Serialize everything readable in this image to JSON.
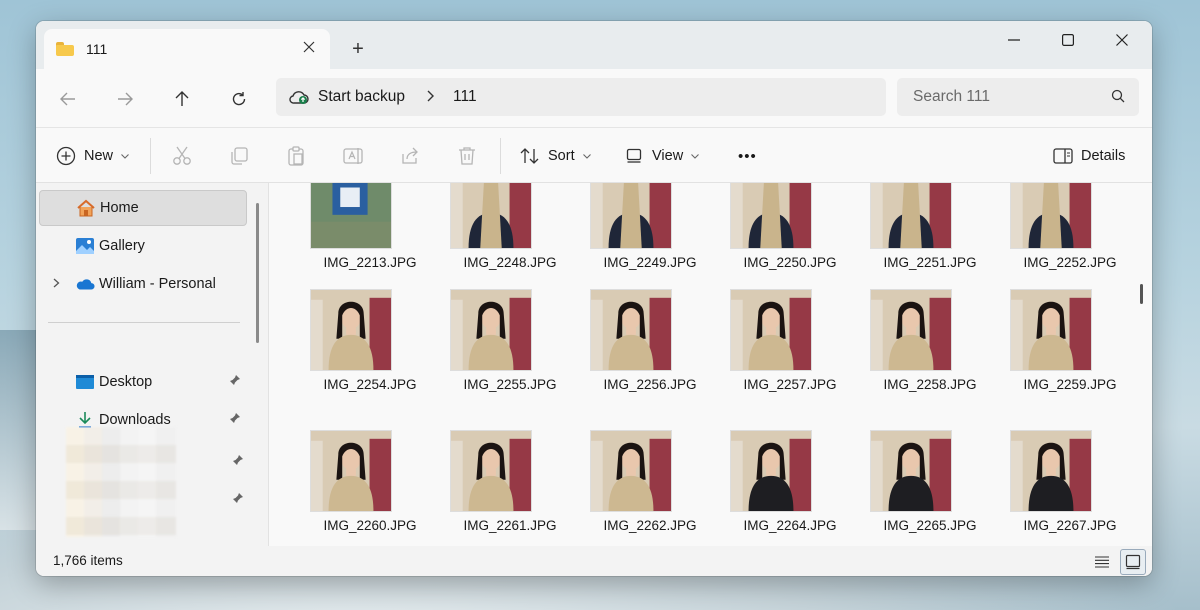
{
  "window": {
    "tab_title": "111",
    "new_tab_symbol": "+"
  },
  "address": {
    "crumbs": [
      "Start backup",
      "111"
    ],
    "search_placeholder": "Search 111"
  },
  "commands": {
    "new_label": "New",
    "sort_label": "Sort",
    "view_label": "View",
    "more_label": "•••",
    "details_label": "Details"
  },
  "sidebar": {
    "items": [
      {
        "label": "Home",
        "icon": "home-icon"
      },
      {
        "label": "Gallery",
        "icon": "gallery-icon"
      },
      {
        "label": "William - Personal",
        "icon": "onedrive-cloud-icon"
      },
      {
        "label": "Desktop",
        "icon": "desktop-icon"
      },
      {
        "label": "Downloads",
        "icon": "downloads-icon"
      }
    ]
  },
  "files": {
    "rows": [
      [
        "IMG_2213.JPG",
        "IMG_2248.JPG",
        "IMG_2249.JPG",
        "IMG_2250.JPG",
        "IMG_2251.JPG",
        "IMG_2252.JPG"
      ],
      [
        "IMG_2254.JPG",
        "IMG_2255.JPG",
        "IMG_2256.JPG",
        "IMG_2257.JPG",
        "IMG_2258.JPG",
        "IMG_2259.JPG"
      ],
      [
        "IMG_2260.JPG",
        "IMG_2261.JPG",
        "IMG_2262.JPG",
        "IMG_2264.JPG",
        "IMG_2265.JPG",
        "IMG_2267.JPG"
      ]
    ]
  },
  "status": {
    "item_count": "1,766 items"
  },
  "colors": {
    "accent": "#0067c0",
    "folder": "#f7c94c"
  }
}
